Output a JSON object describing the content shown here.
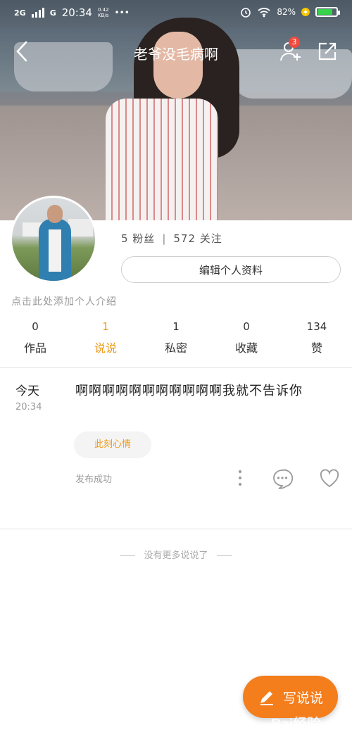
{
  "status_bar": {
    "network": "2G",
    "network2": "G",
    "time": "20:34",
    "speed_top": "0.42",
    "speed_unit": "KB/s",
    "dots": "•••",
    "battery": "82%"
  },
  "nav": {
    "title": "老爷没毛病啊",
    "badge_count": "3"
  },
  "profile": {
    "fans": "5 粉丝",
    "separator": "|",
    "following": "572 关注",
    "edit_button": "编辑个人资料",
    "intro_placeholder": "点击此处添加个人介绍"
  },
  "tabs": [
    {
      "num": "0",
      "label": "作品"
    },
    {
      "num": "1",
      "label": "说说"
    },
    {
      "num": "1",
      "label": "私密"
    },
    {
      "num": "0",
      "label": "收藏"
    },
    {
      "num": "134",
      "label": "赞"
    }
  ],
  "post": {
    "day": "今天",
    "time": "20:34",
    "content": "啊啊啊啊啊啊啊啊啊啊啊我就不告诉你",
    "mood_tag": "此刻心情",
    "status": "发布成功"
  },
  "footer": {
    "no_more": "没有更多说说了"
  },
  "fab": {
    "label": "写说说"
  },
  "watermark": "Bai经验",
  "colors": {
    "accent": "#ee9a1a",
    "fab": "#f47d1c",
    "badge": "#f04a3e",
    "battery": "#35d24a"
  },
  "icons": [
    "back-arrow-icon",
    "add-friend-icon",
    "share-icon",
    "more-vertical-icon",
    "comment-icon",
    "heart-icon",
    "pencil-icon",
    "alarm-icon",
    "wifi-icon"
  ]
}
